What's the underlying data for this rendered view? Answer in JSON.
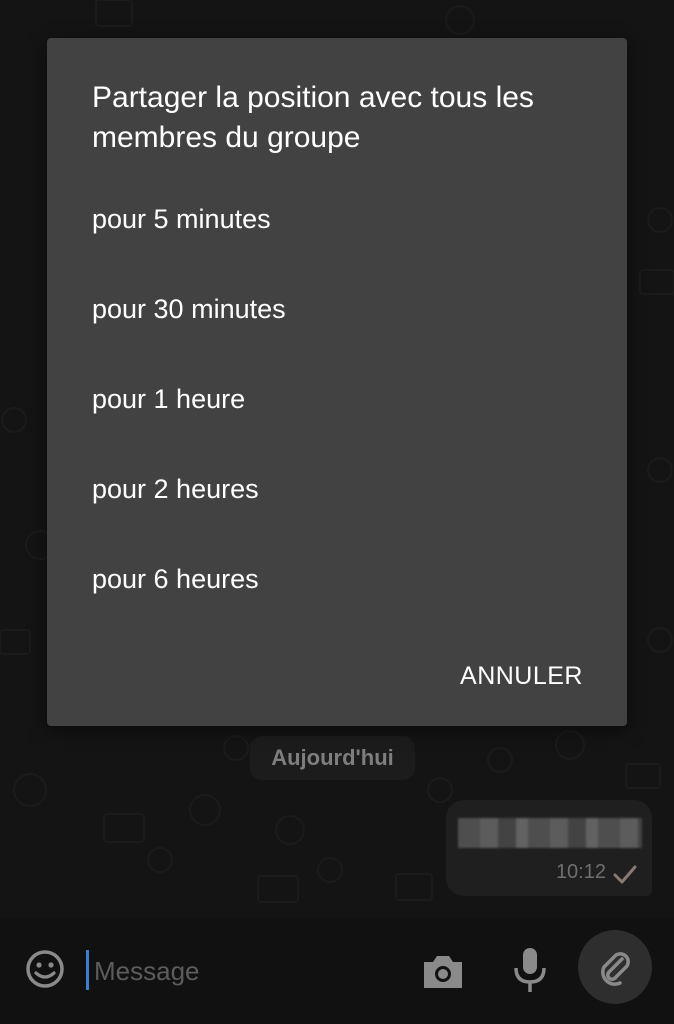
{
  "dialog": {
    "title": "Partager la position avec tous les membres du groupe",
    "options": [
      {
        "label": "pour 5 minutes"
      },
      {
        "label": "pour 30 minutes"
      },
      {
        "label": "pour 1 heure"
      },
      {
        "label": "pour 2 heures"
      },
      {
        "label": "pour 6 heures"
      }
    ],
    "cancel_label": "ANNULER"
  },
  "chat": {
    "date_chip": "Aujourd'hui",
    "message": {
      "time": "10:12",
      "status_icon": "single-check-icon"
    }
  },
  "input_bar": {
    "placeholder": "Message",
    "icons": [
      "emoji-icon",
      "camera-icon",
      "microphone-icon",
      "paperclip-icon"
    ]
  },
  "colors": {
    "background": "#141414",
    "dialog": "#424242",
    "text": "#ffffff",
    "cursor": "#3a7fd0"
  }
}
